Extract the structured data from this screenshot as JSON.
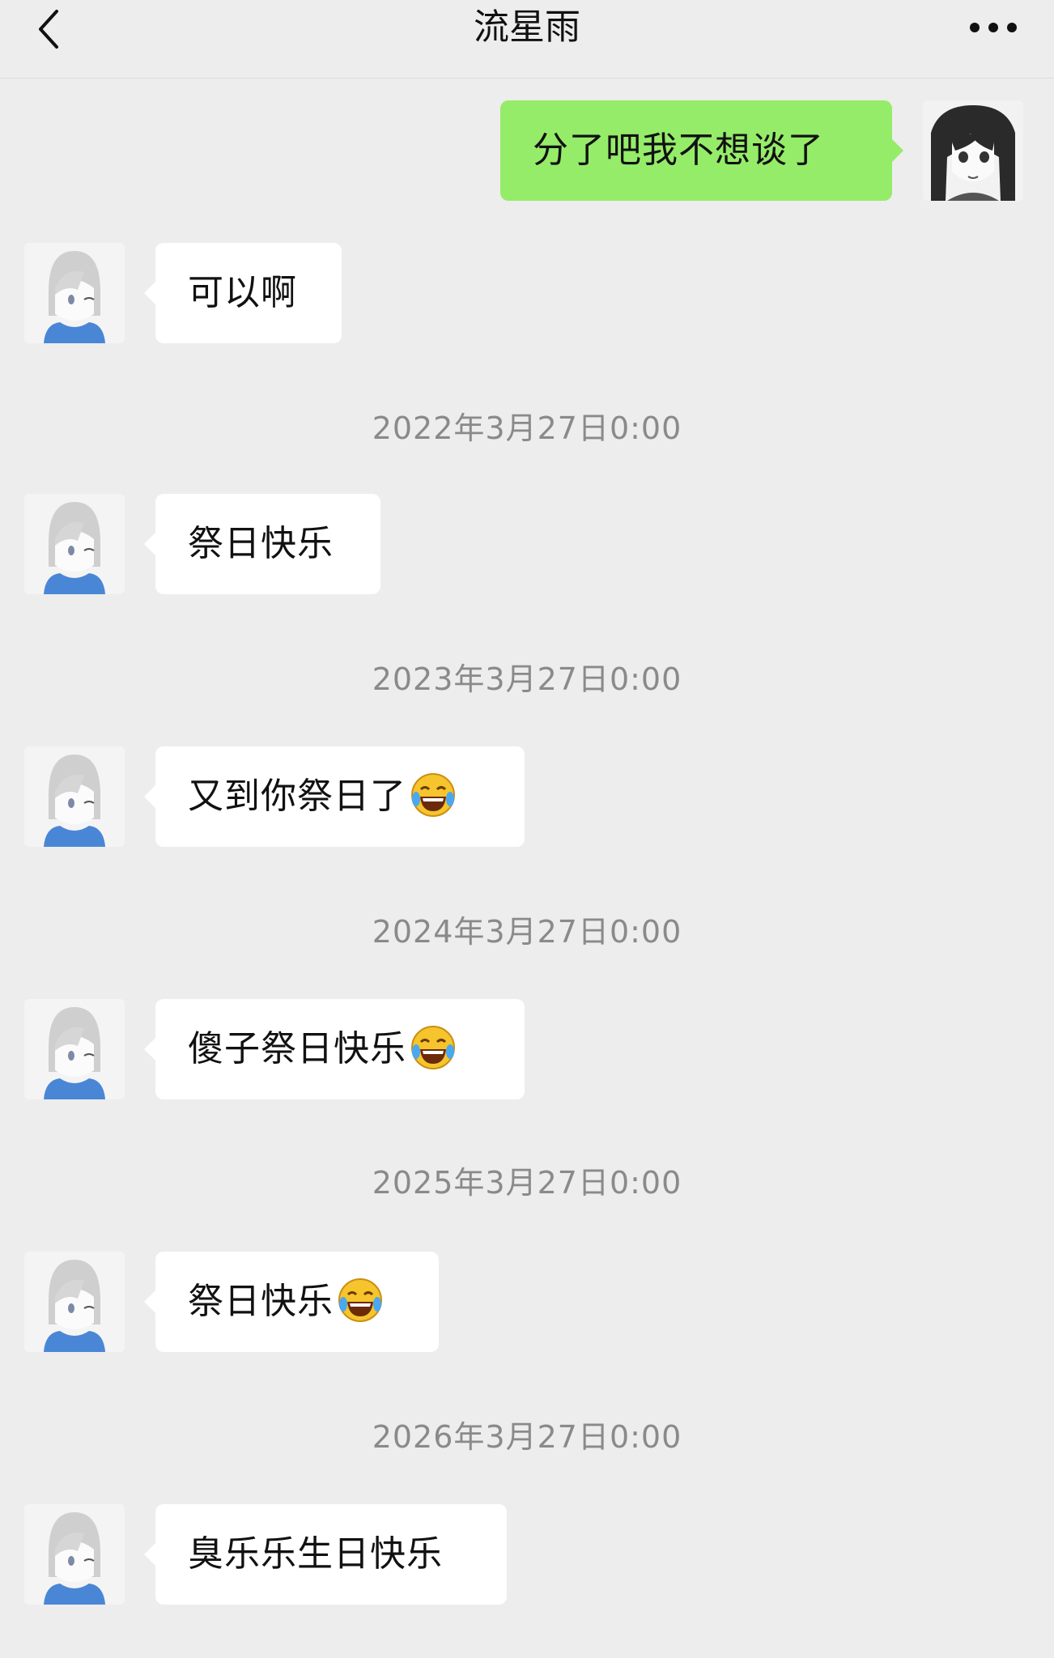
{
  "header": {
    "title": "流星雨",
    "back_icon": "chevron-left-icon",
    "more_icon": "more-dots-icon"
  },
  "messages": [
    {
      "type": "outgoing",
      "text": "分了吧我不想谈了"
    },
    {
      "type": "incoming",
      "text": "可以啊"
    },
    {
      "type": "timestamp",
      "text": "2022年3月27日0:00"
    },
    {
      "type": "incoming",
      "text": "祭日快乐"
    },
    {
      "type": "timestamp",
      "text": "2023年3月27日0:00"
    },
    {
      "type": "incoming",
      "text": "又到你祭日了",
      "emoji": "laughing-tears-emoji"
    },
    {
      "type": "timestamp",
      "text": "2024年3月27日0:00"
    },
    {
      "type": "incoming",
      "text": "傻子祭日快乐",
      "emoji": "laughing-tears-emoji"
    },
    {
      "type": "timestamp",
      "text": "2025年3月27日0:00"
    },
    {
      "type": "incoming",
      "text": "祭日快乐",
      "emoji": "laughing-tears-emoji"
    },
    {
      "type": "timestamp",
      "text": "2026年3月27日0:00"
    },
    {
      "type": "incoming",
      "text": "臭乐乐生日快乐"
    }
  ],
  "colors": {
    "background": "#ededed",
    "outgoing_bubble": "#95ec69",
    "incoming_bubble": "#ffffff",
    "timestamp_text": "#8a8a8a"
  }
}
